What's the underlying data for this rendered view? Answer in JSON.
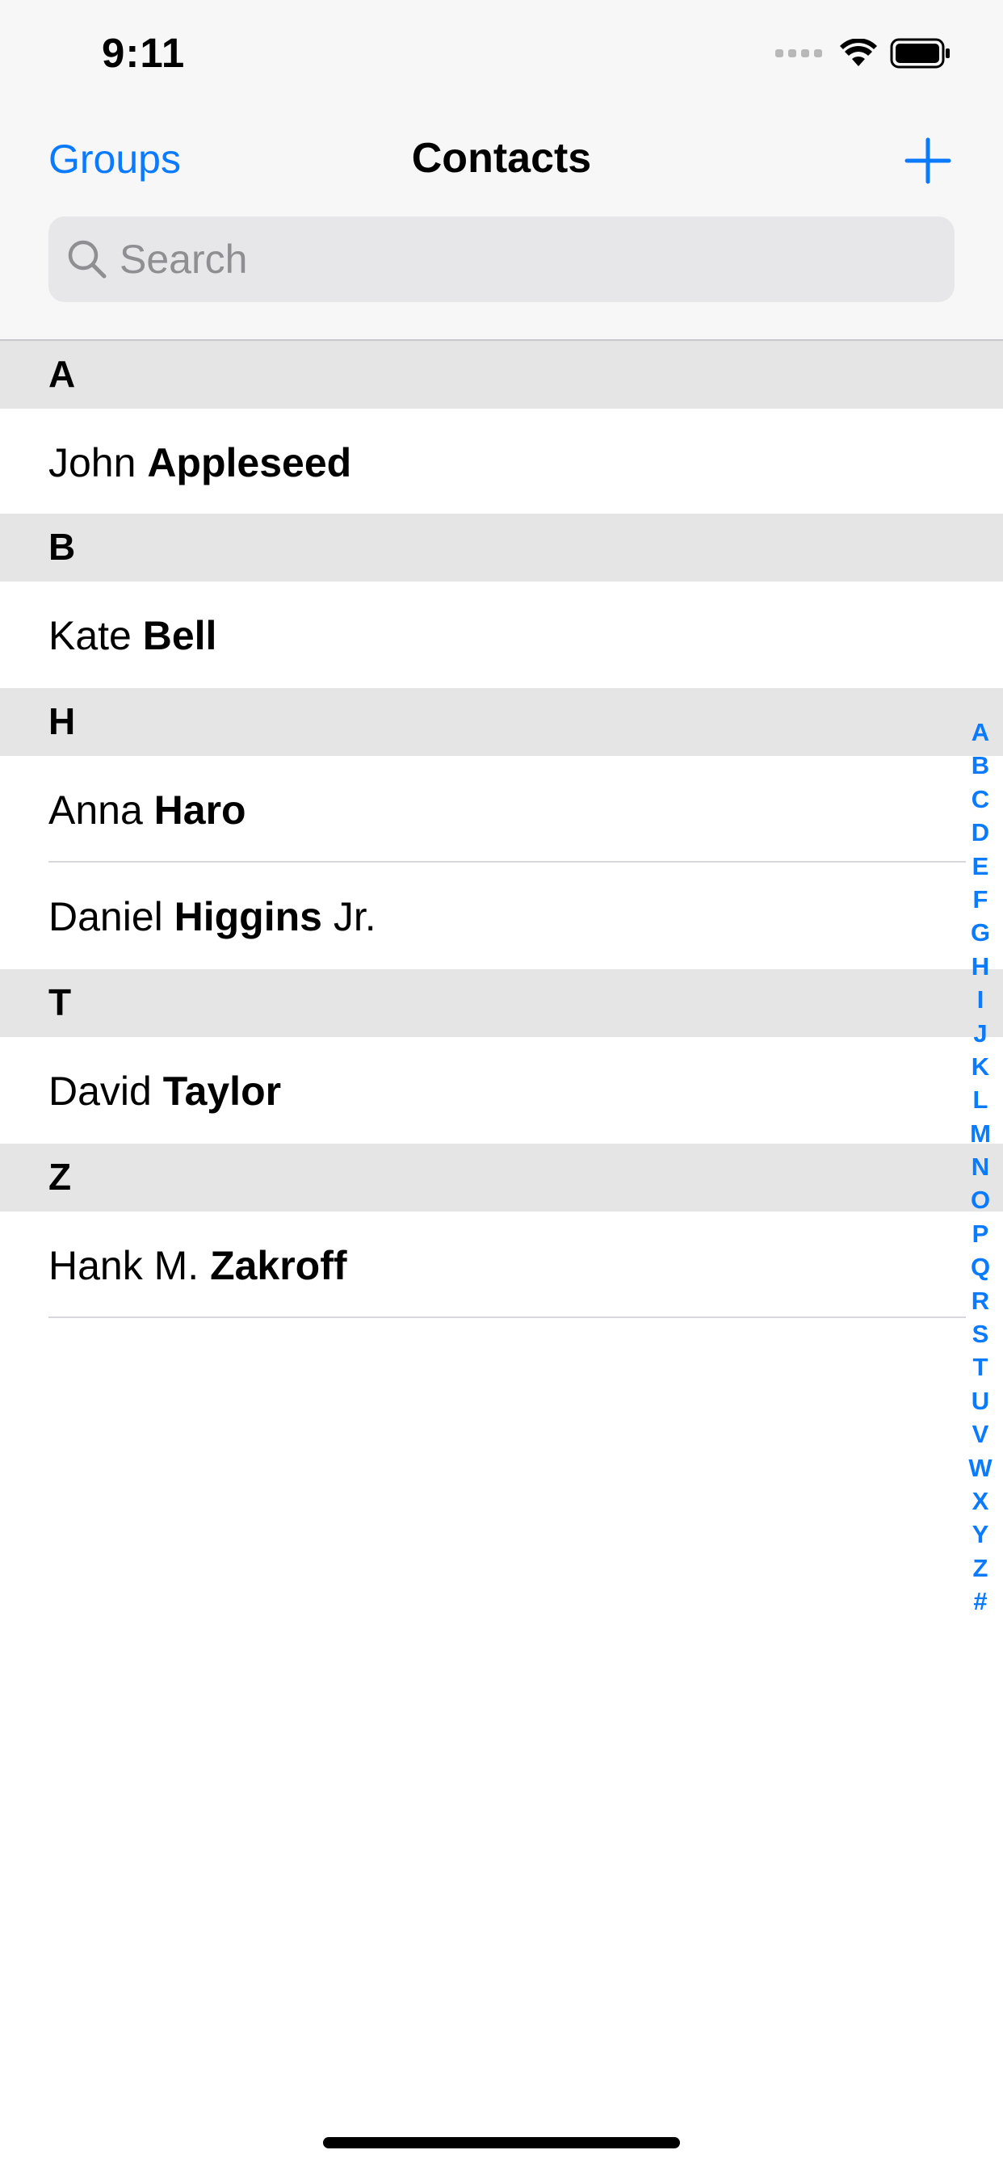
{
  "status_bar": {
    "time": "9:11"
  },
  "nav": {
    "groups_label": "Groups",
    "title": "Contacts",
    "add_icon": "plus-icon"
  },
  "search": {
    "placeholder": "Search",
    "value": ""
  },
  "sections": [
    {
      "letter": "A",
      "contacts": [
        {
          "first": "John ",
          "last": "Appleseed",
          "suffix": ""
        }
      ]
    },
    {
      "letter": "B",
      "contacts": [
        {
          "first": "Kate ",
          "last": "Bell",
          "suffix": ""
        }
      ]
    },
    {
      "letter": "H",
      "contacts": [
        {
          "first": "Anna ",
          "last": "Haro",
          "suffix": ""
        },
        {
          "first": "Daniel ",
          "last": "Higgins",
          "suffix": " Jr."
        }
      ]
    },
    {
      "letter": "T",
      "contacts": [
        {
          "first": "David ",
          "last": "Taylor",
          "suffix": ""
        }
      ]
    },
    {
      "letter": "Z",
      "contacts": [
        {
          "first": "Hank M. ",
          "last": "Zakroff",
          "suffix": ""
        }
      ]
    }
  ],
  "index_letters": [
    "A",
    "B",
    "C",
    "D",
    "E",
    "F",
    "G",
    "H",
    "I",
    "J",
    "K",
    "L",
    "M",
    "N",
    "O",
    "P",
    "Q",
    "R",
    "S",
    "T",
    "U",
    "V",
    "W",
    "X",
    "Y",
    "Z",
    "#"
  ],
  "colors": {
    "accent": "#0a7aff",
    "section_header_bg": "#e5e5e5",
    "nav_bg": "#f7f7f7",
    "search_bg": "#e7e7e9"
  }
}
